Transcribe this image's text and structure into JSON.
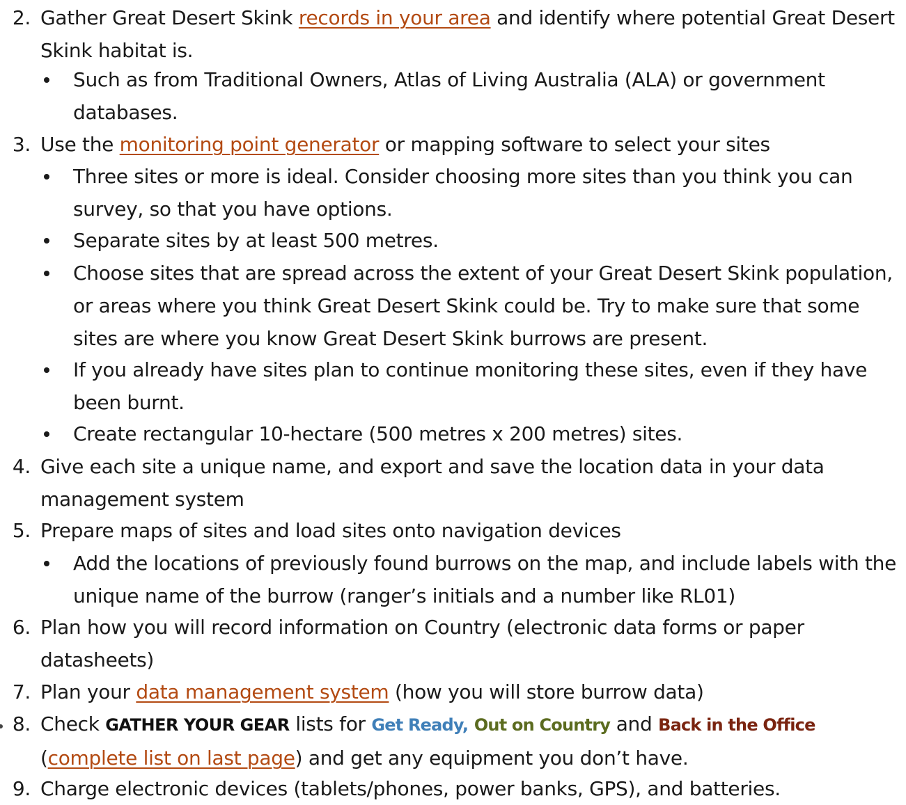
{
  "steps": [
    {
      "number": "2.",
      "text_before": "Gather Great Desert Skink ",
      "link": "records in your area",
      "text_after": " and identify where potential Great Desert Skink habitat is.",
      "bullets": [
        "Such as from Traditional Owners, Atlas of Living Australia (ALA) or government databases."
      ]
    },
    {
      "number": "3.",
      "text_before": "Use the ",
      "link": "monitoring point generator",
      "text_after": " or mapping software to select your sites",
      "bullets": [
        "Three sites or more is ideal. Consider choosing more sites than you think you can survey, so that you have options.",
        "Separate sites by at least 500 metres.",
        "Choose sites that are spread across the extent of your Great Desert Skink population, or areas where you think Great Desert Skink could be. Try to make sure that some sites are where you know Great Desert Skink burrows are present.",
        "If you already have sites plan to continue monitoring these sites, even if they have been burnt.",
        "Create rectangular 10-hectare (500 metres x 200 metres) sites."
      ]
    },
    {
      "number": "4.",
      "text": "Give each site a unique name, and export and save the location data in your data management system"
    },
    {
      "number": "5.",
      "text": "Prepare maps of sites and load sites onto navigation devices",
      "bullets": [
        "Add the locations of previously found burrows on the map, and include labels with the unique name of the burrow (ranger’s initials and a number like RL01)"
      ]
    },
    {
      "number": "6.",
      "text": "Plan how you will record information on Country (electronic data forms or paper datasheets)"
    },
    {
      "number": "7.",
      "text_before": "Plan your ",
      "link": "data management system",
      "text_after": " (how you will store burrow data)"
    },
    {
      "number": "8.",
      "text_before": "Check ",
      "gear_title": "GATHER YOUR GEAR",
      "text_middle": " lists for ",
      "list_get_ready": "Get Ready,",
      "list_out_country": "Out on Country",
      "text_and": " and ",
      "list_back_office": "Back in the Office",
      "paren_open": " (",
      "link": "complete list on last page",
      "text_after": ") and get any equipment you don’t have."
    },
    {
      "number": "9.",
      "text": "Charge electronic devices (tablets/phones, power banks, GPS), and batteries."
    }
  ],
  "colors": {
    "link": "#b34a12",
    "get_ready": "#3f7fb8",
    "out_on_country": "#5b6b1f",
    "back_in_the_office": "#7a2410",
    "body_text": "#1a1a1a"
  }
}
